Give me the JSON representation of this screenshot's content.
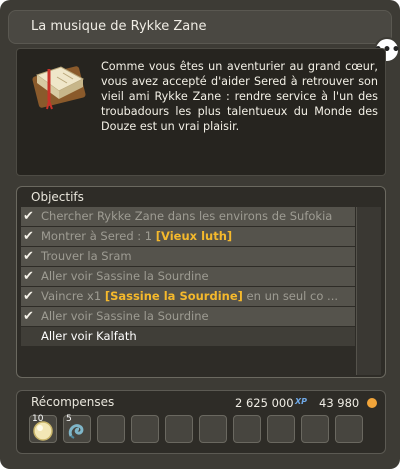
{
  "header": {
    "title": "La musique de Rykke Zane"
  },
  "description": {
    "text": "Comme vous êtes un aventurier au grand cœur, vous avez accepté d'aider Sered à retrouver son vieil ami Rykke Zane : rendre service à l'un des troubadours les plus talentueux du Monde des Douze est un vrai plaisir."
  },
  "objectives": {
    "label": "Objectifs",
    "items": [
      {
        "text": "Chercher Rykke Zane dans les environs de Sufokia",
        "done": true
      },
      {
        "prefix": "Montrer à Sered : 1 ",
        "highlight": "[Vieux luth]",
        "suffix": "",
        "done": true
      },
      {
        "text": "Trouver la Sram",
        "done": true
      },
      {
        "text": "Aller voir Sassine la Sourdine",
        "done": true
      },
      {
        "prefix": "Vaincre x1 ",
        "highlight": "[Sassine la Sourdine]",
        "suffix": " en un seul co ...",
        "done": true
      },
      {
        "text": "Aller voir Sassine la Sourdine",
        "done": true
      },
      {
        "text": "Aller voir Kalfath",
        "done": false
      }
    ]
  },
  "rewards": {
    "label": "Récompenses",
    "xp": "2 625 000",
    "xp_icon": "XP",
    "kamas": "43 980",
    "items": [
      {
        "qty": "10",
        "icon": "orb-icon"
      },
      {
        "qty": "5",
        "icon": "scroll-icon"
      },
      {
        "qty": "",
        "icon": ""
      },
      {
        "qty": "",
        "icon": ""
      },
      {
        "qty": "",
        "icon": ""
      },
      {
        "qty": "",
        "icon": ""
      },
      {
        "qty": "",
        "icon": ""
      },
      {
        "qty": "",
        "icon": ""
      },
      {
        "qty": "",
        "icon": ""
      },
      {
        "qty": "",
        "icon": ""
      }
    ]
  },
  "colors": {
    "panel": "#3d3b35",
    "highlight": "#f5b92c",
    "xp": "#6fa8e6",
    "kamas": "#f2a53a"
  }
}
